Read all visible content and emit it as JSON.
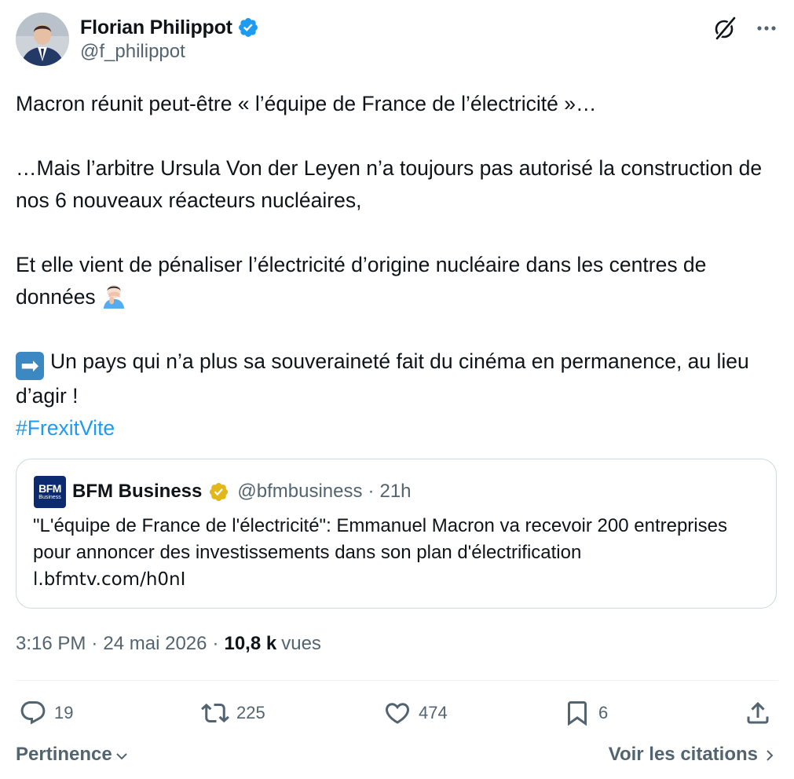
{
  "author": {
    "name": "Florian Philippot",
    "handle": "@f_philippot"
  },
  "tweet": {
    "line1": "Macron réunit peut-être « l’équipe de France de l’électricité »…",
    "line2": "…Mais l’arbitre Ursula Von der Leyen n’a toujours pas autorisé la construction de nos 6 nouveaux réacteurs nucléaires,",
    "line3": "Et elle vient de pénaliser l’électricité d’origine nucléaire dans les centres de données",
    "line4": "Un pays qui n’a plus sa souveraineté fait du cinéma en permanence, au lieu d’agir !",
    "arrow_emoji": "➡",
    "hashtag": "#FrexitVite"
  },
  "quote": {
    "logo_top": "BFM",
    "logo_bottom": "Business",
    "name": "BFM Business",
    "handle": "@bfmbusiness",
    "separator": "·",
    "time": "21h",
    "text": "\"L'équipe de France de l'électricité\": Emmanuel Macron va recevoir 200 entreprises pour annoncer des investissements dans son plan d'électrification",
    "link": "l.bfmtv.com/h0nI"
  },
  "meta": {
    "time": "3:16 PM",
    "separator": "·",
    "date": "24 mai 2026",
    "views_count": "10,8 k",
    "views_label": "vues"
  },
  "actions": {
    "replies": "19",
    "reposts": "225",
    "likes": "474",
    "bookmarks": "6"
  },
  "footer": {
    "sort_label": "Pertinence",
    "quotes_label": "Voir les citations"
  },
  "colors": {
    "text": "#0f1419",
    "secondary": "#536471",
    "link": "#1d9bf0",
    "verified_blue": "#1d9bf0",
    "verified_gold": "#e2b719",
    "border": "#cfd9de"
  },
  "icons": {
    "verified": "verified-badge-icon",
    "grok": "grok-icon",
    "more": "more-icon",
    "reply": "reply-icon",
    "repost": "repost-icon",
    "like": "heart-icon",
    "bookmark": "bookmark-icon",
    "share": "share-icon"
  }
}
